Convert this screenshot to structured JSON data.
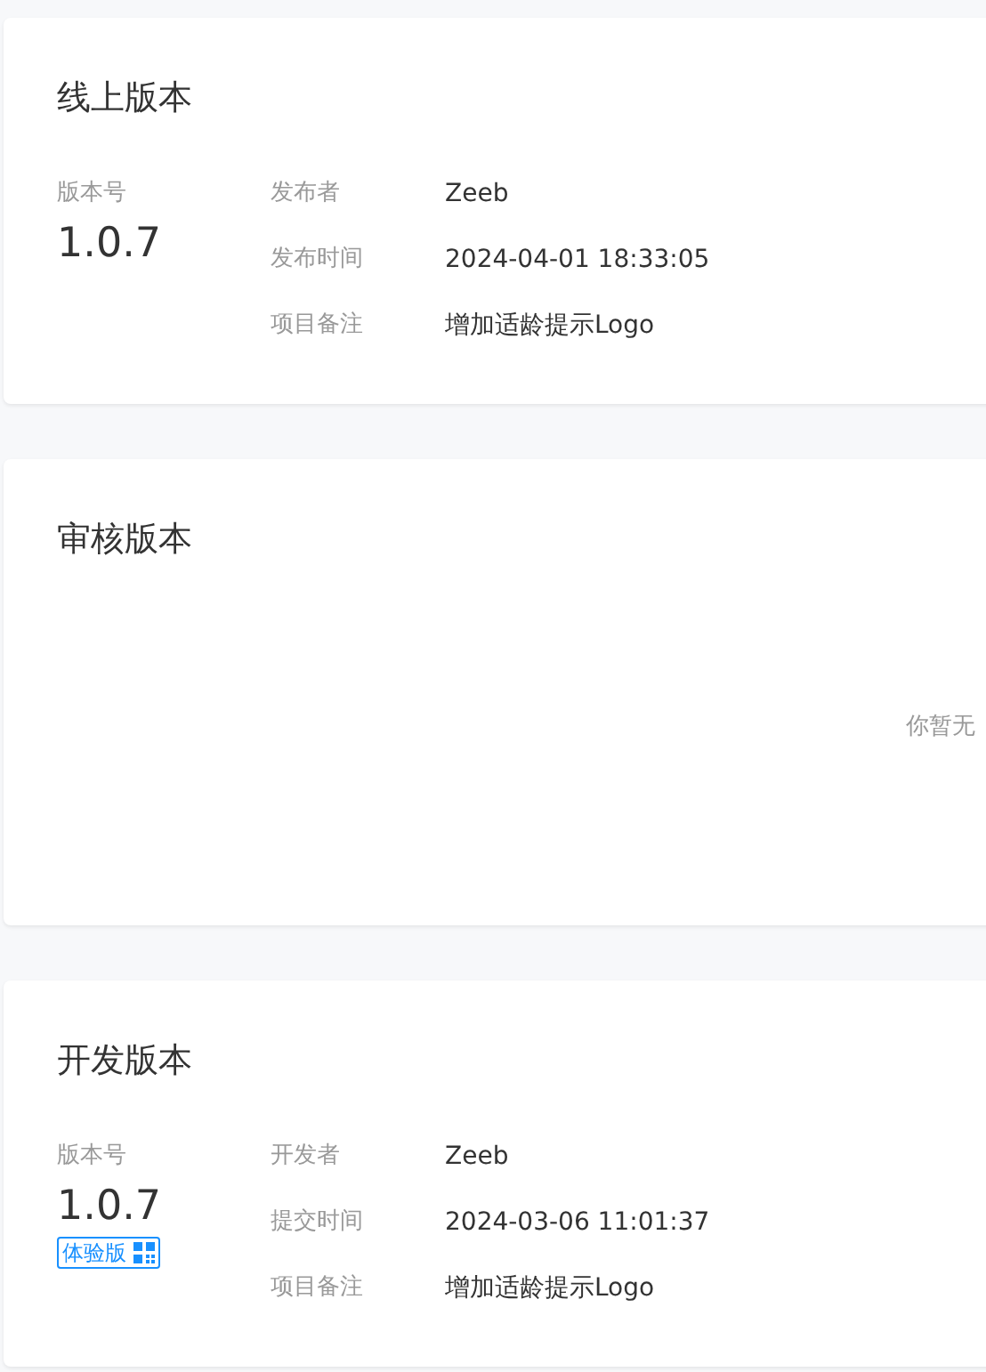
{
  "sections": [
    {
      "kind": "details",
      "title": "线上版本",
      "version_label": "版本号",
      "version": "1.0.7",
      "fields": [
        {
          "label": "发布者",
          "value": "Zeeb"
        },
        {
          "label": "发布时间",
          "value": "2024-04-01 18:33:05"
        },
        {
          "label": "项目备注",
          "value": "增加适龄提示Logo"
        }
      ]
    },
    {
      "kind": "empty",
      "title": "审核版本",
      "empty_text": "你暂无"
    },
    {
      "kind": "details",
      "title": "开发版本",
      "version_label": "版本号",
      "version": "1.0.7",
      "tag": "体验版",
      "fields": [
        {
          "label": "开发者",
          "value": "Zeeb"
        },
        {
          "label": "提交时间",
          "value": "2024-03-06 11:01:37"
        },
        {
          "label": "项目备注",
          "value": "增加适龄提示Logo"
        }
      ]
    }
  ]
}
